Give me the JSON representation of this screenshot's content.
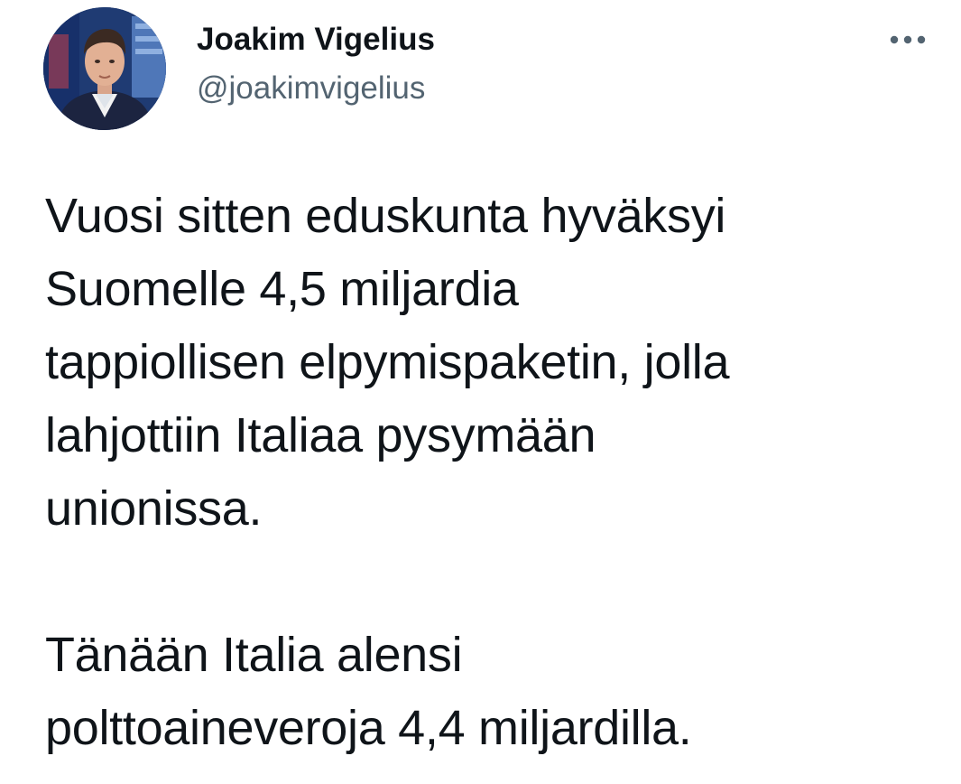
{
  "author": {
    "display_name": "Joakim Vigelius",
    "handle": "@joakimvigelius",
    "avatar_icon": "profile-photo"
  },
  "more_icon": "more-horizontal-icon",
  "tweet": {
    "paragraphs": [
      [
        "Vuosi sitten eduskunta hyväksyi",
        "Suomelle 4,5 miljardia",
        "tappiollisen elpymispaketin, jolla",
        "lahjottiin Italiaa pysymään",
        "unionissa."
      ],
      [
        "Tänään Italia alensi",
        "polttoaineveroja 4,4 miljardilla."
      ]
    ]
  },
  "colors": {
    "text": "#0f1419",
    "secondary_text": "#536471",
    "background": "#ffffff"
  }
}
